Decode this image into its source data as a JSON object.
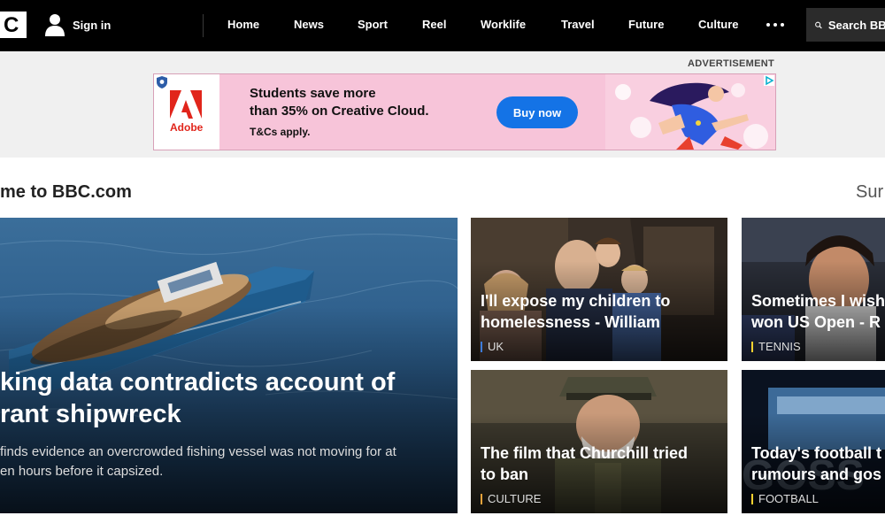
{
  "nav": {
    "logo_text": "C",
    "signin_label": "Sign in",
    "items": [
      "Home",
      "News",
      "Sport",
      "Reel",
      "Worklife",
      "Travel",
      "Future",
      "Culture"
    ],
    "search_label": "Search BBC"
  },
  "ad": {
    "label": "ADVERTISEMENT",
    "brand": "Adobe",
    "headline_line1": "Students save more",
    "headline_line2": "than 35% on Creative Cloud.",
    "tc": "T&Cs apply.",
    "button": "Buy now"
  },
  "section": {
    "title": "me to BBC.com",
    "right_cut": "Sur"
  },
  "main_story": {
    "title_line1": "king data contradicts account of",
    "title_line2": "rant shipwreck",
    "summary_line1": "finds evidence an overcrowded fishing vessel was not moving for at",
    "summary_line2": "en hours before it capsized."
  },
  "stories": [
    {
      "title_line1": "I'll expose my children to",
      "title_line2": "homelessness - William",
      "tag": "UK"
    },
    {
      "title_line1": "Sometimes I wish",
      "title_line2": "won US Open - R",
      "tag": "TENNIS"
    },
    {
      "title_line1": "The film that Churchill tried",
      "title_line2": "to ban",
      "tag": "CULTURE"
    },
    {
      "title_line1": "Today's football t",
      "title_line2": "rumours and gos",
      "tag": "FOOTBALL"
    }
  ],
  "colors": {
    "tag_news": "#3d7bd9",
    "tag_sport": "#ffd230",
    "tag_culture": "#e8a33b",
    "ad_button": "#1473e6",
    "adobe_red": "#e1251b"
  }
}
